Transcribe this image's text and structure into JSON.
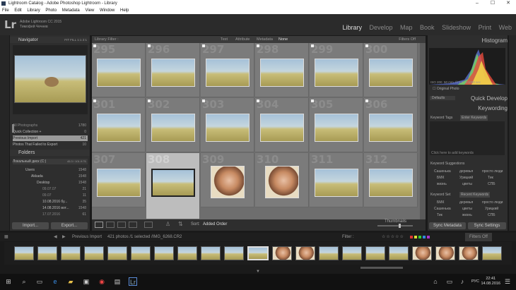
{
  "window": {
    "title": "Lightroom Catalog - Adobe Photoshop Lightroom - Library"
  },
  "menu": [
    "File",
    "Edit",
    "Library",
    "Photo",
    "Metadata",
    "View",
    "Window",
    "Help"
  ],
  "identity": {
    "logo": "Lr",
    "line1": "Adobe Lightroom CC 2015",
    "line2": "Тимофей Чечнев"
  },
  "modules": [
    "Library",
    "Develop",
    "Map",
    "Book",
    "Slideshow",
    "Print",
    "Web"
  ],
  "navigator": {
    "title": "Navigator",
    "opts": "FIT   FILL   1:1   2:1"
  },
  "catalog": {
    "items": [
      {
        "label": "All Photographs",
        "count": "1780"
      },
      {
        "label": "Quick Collection +",
        "count": "0"
      },
      {
        "label": "Previous Import",
        "count": "421"
      },
      {
        "label": "Photos That Failed to Export",
        "count": "10"
      }
    ]
  },
  "folders": {
    "title": "Folders",
    "volume": {
      "label": "Локальный диск (C:)",
      "info": "45.3 / 101.9 ГБ"
    },
    "items": [
      {
        "label": "Users",
        "count": "1548"
      },
      {
        "label": "Akkada",
        "count": "1548"
      },
      {
        "label": "Desktop",
        "count": "1548"
      },
      {
        "label": "09.07.07",
        "count": "21"
      },
      {
        "label": "09.07",
        "count": "11"
      },
      {
        "label": "10.08.2016 бу...",
        "count": "35"
      },
      {
        "label": "14.08.2016 вот...",
        "count": "1548"
      },
      {
        "label": "17.07.2016",
        "count": "61"
      }
    ]
  },
  "left_buttons": {
    "import": "Import...",
    "export": "Export..."
  },
  "filter": {
    "label": "Library Filter :",
    "tabs": [
      "Text",
      "Attribute",
      "Metadata",
      "None"
    ],
    "state": "Filters Off"
  },
  "grid": {
    "cells": [
      {
        "num": "295",
        "kind": "sky"
      },
      {
        "num": "296",
        "kind": "sky"
      },
      {
        "num": "297",
        "kind": "sky"
      },
      {
        "num": "298",
        "kind": "sky"
      },
      {
        "num": "299",
        "kind": "sky"
      },
      {
        "num": "300",
        "kind": "sky"
      },
      {
        "num": "301",
        "kind": "sky"
      },
      {
        "num": "302",
        "kind": "sky"
      },
      {
        "num": "303",
        "kind": "sky"
      },
      {
        "num": "304",
        "kind": "sky"
      },
      {
        "num": "305",
        "kind": "sky"
      },
      {
        "num": "306",
        "kind": "sky"
      },
      {
        "num": "307",
        "kind": "sky"
      },
      {
        "num": "308",
        "kind": "sky",
        "selected": true
      },
      {
        "num": "309",
        "kind": "face"
      },
      {
        "num": "310",
        "kind": "face"
      },
      {
        "num": "311",
        "kind": "sky"
      },
      {
        "num": "312",
        "kind": "sky"
      }
    ]
  },
  "toolbar": {
    "sort_label": "Sort:",
    "sort_value": "Added Order",
    "thumbs": "Thumbnails"
  },
  "right": {
    "histogram": "Histogram",
    "iso": "ISO 200",
    "focal": "50 mm",
    "aperture": "f / 1.8",
    "shutter": "1/1000 sec",
    "original": "Original Photo",
    "preset": "Defaults",
    "quick": "Quick Develop",
    "keywording": "Keywording",
    "kw_tags": "Keyword Tags",
    "kw_enter": "Enter Keywords",
    "kw_hint": "Click here to add keywords",
    "suggestions": "Keyword Suggestions",
    "sugg_words": [
      "Сашенька",
      "деревья",
      "просто люди",
      "БМК",
      "Урицкий",
      "Тик",
      "жизнь",
      "цветы",
      "СПБ"
    ],
    "set_label": "Keyword Set",
    "set_value": "Recent Keywords",
    "set_words": [
      "БМК",
      "деревья",
      "просто люди",
      "Сашенька",
      "цветы",
      "Урицкий",
      "Тик",
      "жизнь",
      "СПБ"
    ],
    "sync_meta": "Sync Metadata",
    "sync_settings": "Sync Settings"
  },
  "filmstrip": {
    "source": "Previous Import",
    "info": "421 photos /1 selected /IMG_6268.CR2",
    "filter": "Filter :",
    "filters_off": "Filters Off"
  },
  "taskbar": {
    "time": "22:41",
    "date": "14.08.2016",
    "lang": "РУС"
  }
}
